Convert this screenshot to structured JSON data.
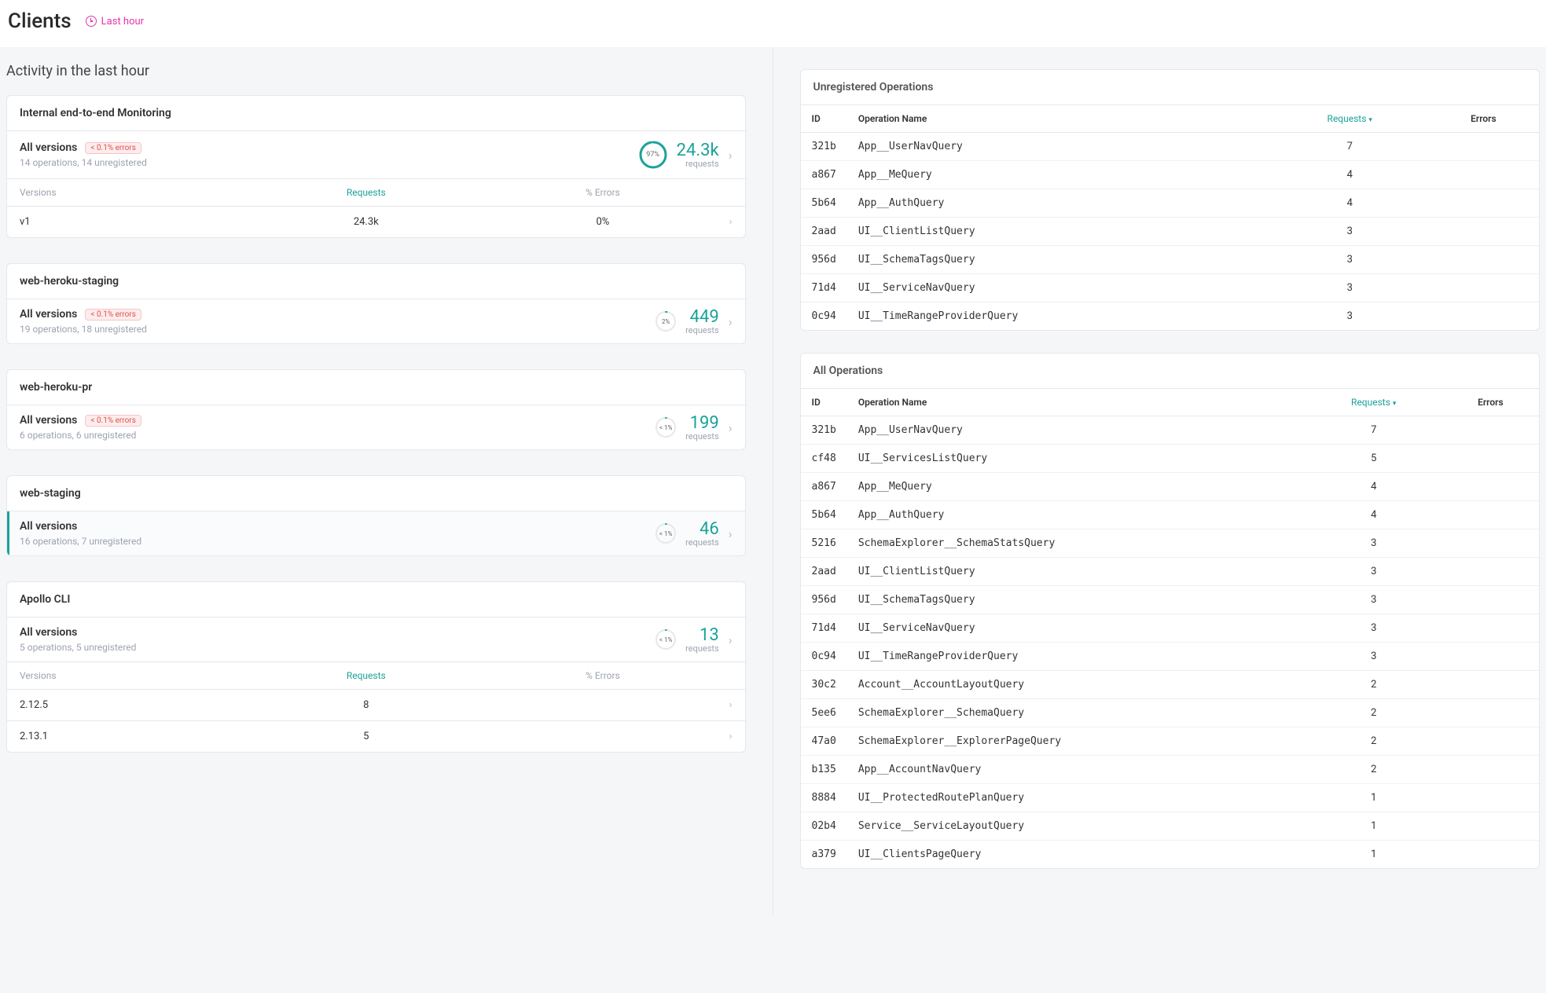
{
  "header": {
    "title": "Clients",
    "time_range": "Last hour"
  },
  "section_title": "Activity in the last hour",
  "columns": {
    "versions": "Versions",
    "requests": "Requests",
    "pct_errors": "% Errors",
    "id": "ID",
    "operation_name": "Operation Name",
    "errors": "Errors"
  },
  "labels": {
    "all_versions": "All versions",
    "requests_word": "requests",
    "error_badge": "< 0.1% errors"
  },
  "clients": [
    {
      "name": "Internal end-to-end Monitoring",
      "error_badge": true,
      "sub": "14 operations, 14 unregistered",
      "pct": "97%",
      "pct_value": 97,
      "requests": "24.3k",
      "selected": false,
      "rows": [
        {
          "version": "v1",
          "requests": "24.3k",
          "pct_errors": "0%"
        }
      ]
    },
    {
      "name": "web-heroku-staging",
      "error_badge": true,
      "sub": "19 operations, 18 unregistered",
      "pct": "2%",
      "pct_value": 2,
      "requests": "449",
      "selected": false,
      "rows": []
    },
    {
      "name": "web-heroku-pr",
      "error_badge": true,
      "sub": "6 operations, 6 unregistered",
      "pct": "< 1%",
      "pct_value": 1,
      "requests": "199",
      "selected": false,
      "rows": []
    },
    {
      "name": "web-staging",
      "error_badge": false,
      "sub": "16 operations, 7 unregistered",
      "pct": "< 1%",
      "pct_value": 1,
      "requests": "46",
      "selected": true,
      "rows": []
    },
    {
      "name": "Apollo CLI",
      "error_badge": false,
      "sub": "5 operations, 5 unregistered",
      "pct": "< 1%",
      "pct_value": 1,
      "requests": "13",
      "selected": false,
      "rows": [
        {
          "version": "2.12.5",
          "requests": "8",
          "pct_errors": ""
        },
        {
          "version": "2.13.1",
          "requests": "5",
          "pct_errors": ""
        }
      ]
    }
  ],
  "panels": [
    {
      "title": "Unregistered Operations",
      "rows": [
        {
          "id": "321b",
          "name": "App__UserNavQuery",
          "requests": "7",
          "errors": ""
        },
        {
          "id": "a867",
          "name": "App__MeQuery",
          "requests": "4",
          "errors": ""
        },
        {
          "id": "5b64",
          "name": "App__AuthQuery",
          "requests": "4",
          "errors": ""
        },
        {
          "id": "2aad",
          "name": "UI__ClientListQuery",
          "requests": "3",
          "errors": ""
        },
        {
          "id": "956d",
          "name": "UI__SchemaTagsQuery",
          "requests": "3",
          "errors": ""
        },
        {
          "id": "71d4",
          "name": "UI__ServiceNavQuery",
          "requests": "3",
          "errors": ""
        },
        {
          "id": "0c94",
          "name": "UI__TimeRangeProviderQuery",
          "requests": "3",
          "errors": ""
        }
      ]
    },
    {
      "title": "All Operations",
      "rows": [
        {
          "id": "321b",
          "name": "App__UserNavQuery",
          "requests": "7",
          "errors": ""
        },
        {
          "id": "cf48",
          "name": "UI__ServicesListQuery",
          "requests": "5",
          "errors": ""
        },
        {
          "id": "a867",
          "name": "App__MeQuery",
          "requests": "4",
          "errors": ""
        },
        {
          "id": "5b64",
          "name": "App__AuthQuery",
          "requests": "4",
          "errors": ""
        },
        {
          "id": "5216",
          "name": "SchemaExplorer__SchemaStatsQuery",
          "requests": "3",
          "errors": ""
        },
        {
          "id": "2aad",
          "name": "UI__ClientListQuery",
          "requests": "3",
          "errors": ""
        },
        {
          "id": "956d",
          "name": "UI__SchemaTagsQuery",
          "requests": "3",
          "errors": ""
        },
        {
          "id": "71d4",
          "name": "UI__ServiceNavQuery",
          "requests": "3",
          "errors": ""
        },
        {
          "id": "0c94",
          "name": "UI__TimeRangeProviderQuery",
          "requests": "3",
          "errors": ""
        },
        {
          "id": "30c2",
          "name": "Account__AccountLayoutQuery",
          "requests": "2",
          "errors": ""
        },
        {
          "id": "5ee6",
          "name": "SchemaExplorer__SchemaQuery",
          "requests": "2",
          "errors": ""
        },
        {
          "id": "47a0",
          "name": "SchemaExplorer__ExplorerPageQuery",
          "requests": "2",
          "errors": ""
        },
        {
          "id": "b135",
          "name": "App__AccountNavQuery",
          "requests": "2",
          "errors": ""
        },
        {
          "id": "8884",
          "name": "UI__ProtectedRoutePlanQuery",
          "requests": "1",
          "errors": ""
        },
        {
          "id": "02b4",
          "name": "Service__ServiceLayoutQuery",
          "requests": "1",
          "errors": ""
        },
        {
          "id": "a379",
          "name": "UI__ClientsPageQuery",
          "requests": "1",
          "errors": ""
        }
      ]
    }
  ]
}
